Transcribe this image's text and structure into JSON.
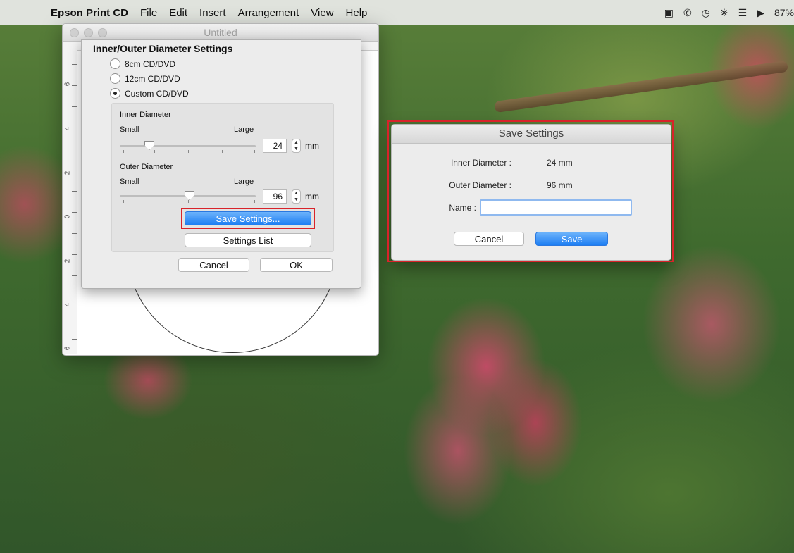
{
  "menubar": {
    "app_name": "Epson Print CD",
    "menus": [
      "File",
      "Edit",
      "Insert",
      "Arrangement",
      "View",
      "Help"
    ],
    "status": {
      "battery": "87%"
    }
  },
  "document_window": {
    "title": "Untitled",
    "ruler_numbers": [
      "6",
      "4",
      "2",
      "0",
      "2",
      "4",
      "6"
    ]
  },
  "diameter_sheet": {
    "title": "Inner/Outer Diameter Settings",
    "options": [
      {
        "label": "8cm CD/DVD",
        "selected": false
      },
      {
        "label": "12cm CD/DVD",
        "selected": false
      },
      {
        "label": "Custom CD/DVD",
        "selected": true
      }
    ],
    "inner": {
      "label": "Inner Diameter",
      "small": "Small",
      "large": "Large",
      "value": "24",
      "unit": "mm"
    },
    "outer": {
      "label": "Outer Diameter",
      "small": "Small",
      "large": "Large",
      "value": "96",
      "unit": "mm"
    },
    "save_settings_label": "Save Settings...",
    "settings_list_label": "Settings List",
    "cancel_label": "Cancel",
    "ok_label": "OK"
  },
  "save_dialog": {
    "title": "Save Settings",
    "inner_label": "Inner Diameter :",
    "inner_value": "24 mm",
    "outer_label": "Outer Diameter :",
    "outer_value": "96 mm",
    "name_label": "Name :",
    "name_value": "",
    "cancel_label": "Cancel",
    "save_label": "Save"
  },
  "colors": {
    "highlight": "#d8232a",
    "accent": "#1d7ef3"
  }
}
